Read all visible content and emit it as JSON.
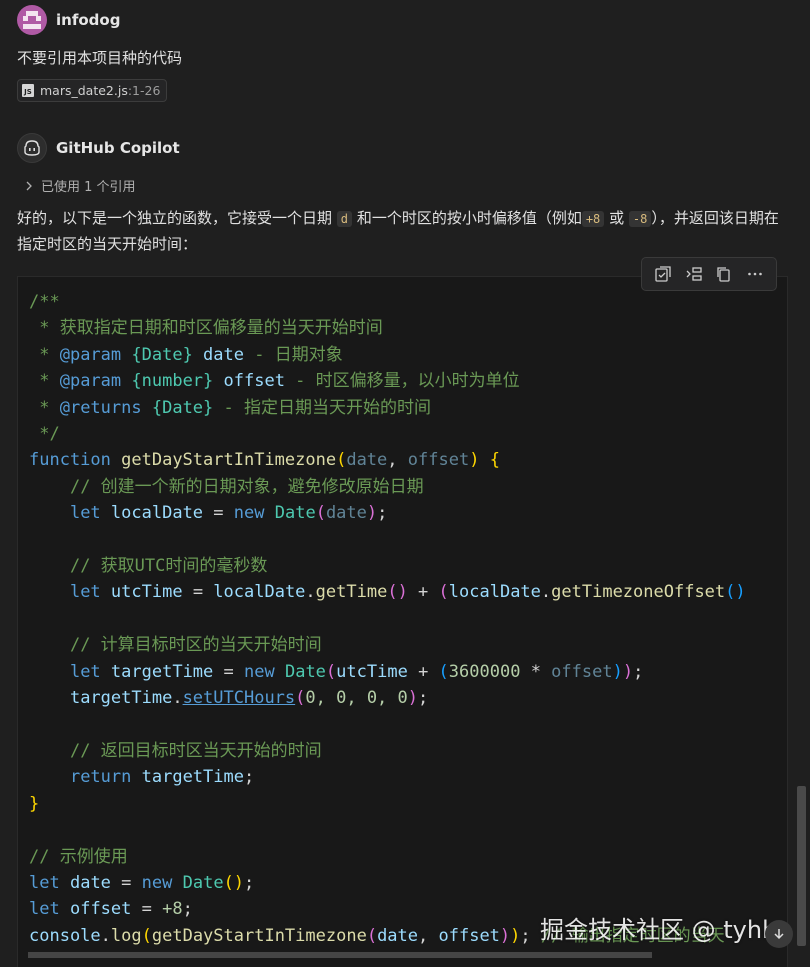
{
  "user": {
    "name": "infodog",
    "message": "不要引用本项目种的代码",
    "attachment": {
      "file": "mars_date2.js",
      "range": ":1-26"
    }
  },
  "assistant": {
    "name": "GitHub Copilot",
    "references": "已使用 1 个引用",
    "intro_1": "好的，以下是一个独立的函数，它接受一个日期",
    "intro_code_1": "d",
    "intro_2": "和一个时区的按小时偏移值（例如",
    "intro_code_2": "+8",
    "intro_3": "或",
    "intro_code_3": "-8",
    "intro_4": "），并返回该日期在指定时区的当天开始时间："
  },
  "code_lines": {
    "l1": "/**",
    "l2": " * 获取指定日期和时区偏移量的当天开始时间",
    "l3_a": " * ",
    "l3_tag": "@param",
    "l3_type": "{Date}",
    "l3_name": " date",
    "l3_desc": " - 日期对象",
    "l4_a": " * ",
    "l4_tag": "@param",
    "l4_type": "{number}",
    "l4_name": " offset",
    "l4_desc": " - 时区偏移量，以小时为单位",
    "l5_a": " * ",
    "l5_tag": "@returns",
    "l5_type": "{Date}",
    "l5_desc": " - 指定日期当天开始的时间",
    "l6": " */",
    "l7_kw": "function",
    "l7_fn": "getDayStartInTimezone",
    "l7_p1": "date",
    "l7_p2": "offset",
    "l8": "// 创建一个新的日期对象，避免修改原始日期",
    "l9_kw": "let",
    "l9_var": "localDate",
    "l9_new": "new",
    "l9_cls": "Date",
    "l9_arg": "date",
    "l11": "// 获取UTC时间的毫秒数",
    "l12_kw": "let",
    "l12_var": "utcTime",
    "l12_obj": "localDate",
    "l12_m1": "getTime",
    "l12_obj2": "localDate",
    "l12_m2": "getTimezoneOffset",
    "l14": "// 计算目标时区的当天开始时间",
    "l15_kw": "let",
    "l15_var": "targetTime",
    "l15_new": "new",
    "l15_cls": "Date",
    "l15_a": "utcTime",
    "l15_num": "3600000",
    "l15_b": "offset",
    "l16_obj": "targetTime",
    "l16_m": "setUTCHours",
    "l16_args": "0, 0, 0, 0",
    "l18": "// 返回目标时区当天开始的时间",
    "l19_kw": "return",
    "l19_var": "targetTime",
    "l22": "// 示例使用",
    "l23_kw": "let",
    "l23_var": "date",
    "l23_new": "new",
    "l23_cls": "Date",
    "l24_kw": "let",
    "l24_var": "offset",
    "l24_val": "+8",
    "l25_obj": "console",
    "l25_m": "log",
    "l25_fn": "getDayStartInTimezone",
    "l25_a": "date",
    "l25_b": "offset",
    "l25_com": "// 输出指定时区的当天"
  },
  "watermark": "掘金技术社区 @ tyhh"
}
